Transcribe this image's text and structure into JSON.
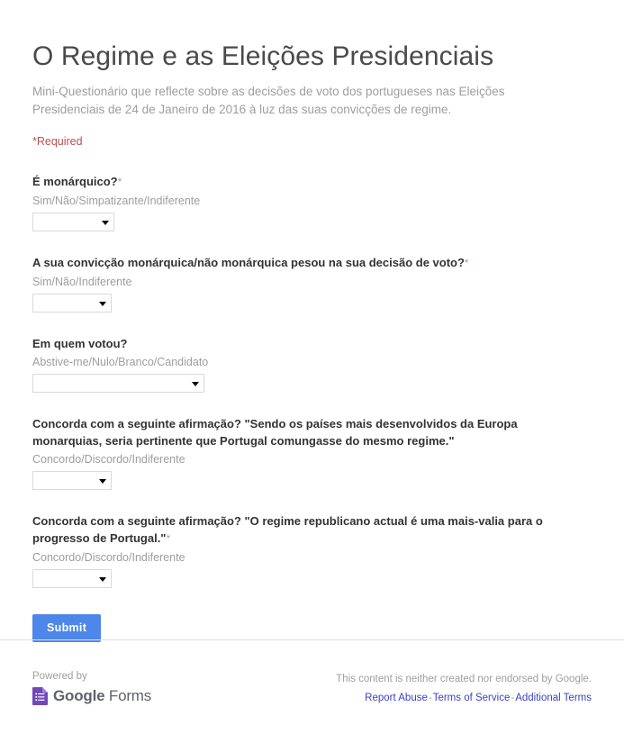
{
  "form": {
    "title": "O Regime e as Eleições Presidenciais",
    "description": "Mini-Questionário que reflecte sobre as decisões de voto dos portugueses nas Eleições Presidenciais de 24 de Janeiro de 2016 à luz das suas convicções de regime.",
    "required_note": "*Required",
    "required_marker": "*"
  },
  "questions": [
    {
      "title": "É monárquico?",
      "required": true,
      "help": "Sim/Não/Simpatizante/Indiferente",
      "selected": "",
      "options": [
        "",
        "Sim",
        "Não",
        "Simpatizante",
        "Indiferente"
      ]
    },
    {
      "title": "A sua convicção monárquica/não monárquica pesou na sua decisão de voto?",
      "required": true,
      "help": "Sim/Não/Indiferente",
      "selected": "",
      "options": [
        "",
        "Sim",
        "Não",
        "Indiferente"
      ]
    },
    {
      "title": "Em quem votou?",
      "required": false,
      "help": "Abstive-me/Nulo/Branco/Candidato",
      "selected": "",
      "options": [
        "",
        "Abstive-me",
        "Nulo",
        "Branco",
        "Candidato"
      ]
    },
    {
      "title": "Concorda com a seguinte afirmação? \"Sendo os países mais desenvolvidos da Europa monarquias, seria pertinente que Portugal comungasse do mesmo regime.\"",
      "required": false,
      "help": "Concordo/Discordo/Indiferente",
      "selected": "",
      "options": [
        "",
        "Concordo",
        "Discordo",
        "Indiferente"
      ]
    },
    {
      "title": "Concorda com a seguinte afirmação? \"O regime republicano actual é uma mais-valia para o progresso de Portugal.\"",
      "required": true,
      "help": "Concordo/Discordo/Indiferente",
      "selected": "",
      "options": [
        "",
        "Concordo",
        "Discordo",
        "Indiferente"
      ]
    }
  ],
  "submit": {
    "label": "Submit"
  },
  "footer": {
    "powered_by": "Powered by",
    "brand_bold": "Google",
    "brand_light": " Forms",
    "disclaimer": "This content is neither created nor endorsed by Google.",
    "links": [
      {
        "label": "Report Abuse"
      },
      {
        "label": "Terms of Service"
      },
      {
        "label": "Additional Terms"
      }
    ],
    "link_separator": "-"
  },
  "colors": {
    "submit_blue": "#4d87ea",
    "required_red": "#c0504d",
    "link_blue": "#3b42c4",
    "forms_purple": "#7248b9",
    "title_gray": "#4a4a4a",
    "help_gray": "#9e9e9e"
  }
}
